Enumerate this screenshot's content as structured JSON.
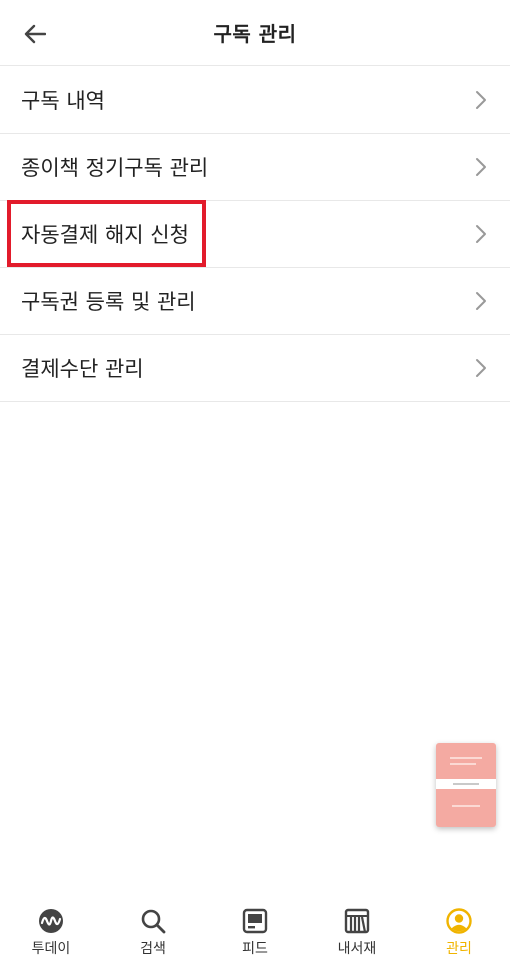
{
  "header": {
    "title": "구독 관리"
  },
  "menu": {
    "items": [
      {
        "label": "구독 내역"
      },
      {
        "label": "종이책 정기구독 관리"
      },
      {
        "label": "자동결제 해지 신청"
      },
      {
        "label": "구독권 등록 및 관리"
      },
      {
        "label": "결제수단 관리"
      }
    ]
  },
  "tabbar": {
    "tabs": [
      {
        "label": "투데이",
        "icon": "today-wave-icon"
      },
      {
        "label": "검색",
        "icon": "search-icon"
      },
      {
        "label": "피드",
        "icon": "feed-icon"
      },
      {
        "label": "내서재",
        "icon": "library-icon"
      },
      {
        "label": "관리",
        "icon": "profile-icon",
        "active": true
      }
    ]
  },
  "colors": {
    "accent": "#f0b400",
    "highlight": "#e21b2b",
    "book": "#f4aaa2"
  }
}
